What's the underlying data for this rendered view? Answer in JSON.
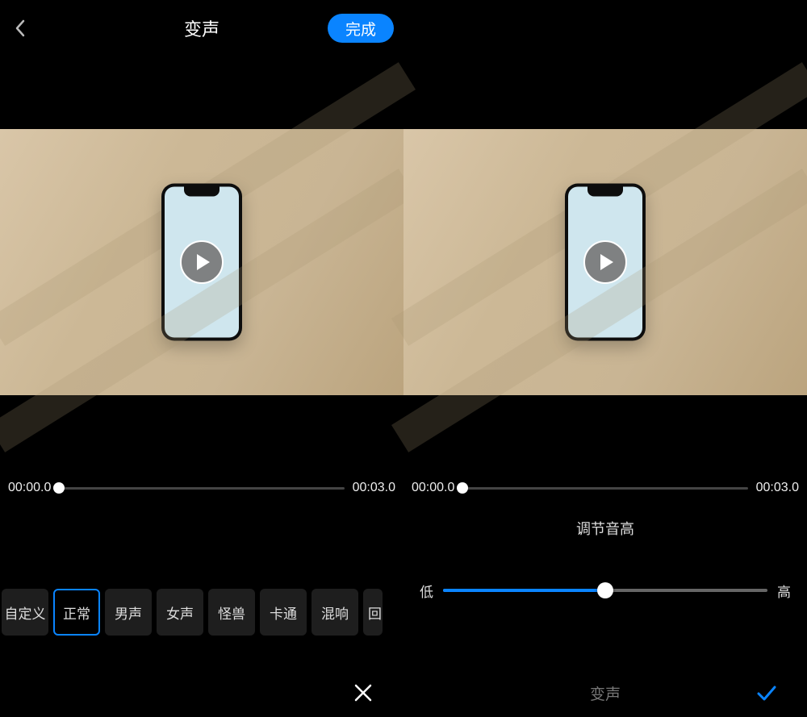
{
  "header": {
    "title": "变声",
    "done_label": "完成"
  },
  "timeline": {
    "start": "00:00.0",
    "end": "00:03.0",
    "progress_pct": 0
  },
  "effects": [
    {
      "label": "自定义",
      "selected": false
    },
    {
      "label": "正常",
      "selected": true
    },
    {
      "label": "男声",
      "selected": false
    },
    {
      "label": "女声",
      "selected": false
    },
    {
      "label": "怪兽",
      "selected": false
    },
    {
      "label": "卡通",
      "selected": false
    },
    {
      "label": "混响",
      "selected": false
    },
    {
      "label": "回",
      "selected": false,
      "partial": true
    }
  ],
  "pitch": {
    "title": "调节音高",
    "low_label": "低",
    "high_label": "高",
    "value_pct": 50
  },
  "bottom_bar": {
    "center_label": "变声"
  },
  "colors": {
    "accent": "#0a84ff"
  }
}
